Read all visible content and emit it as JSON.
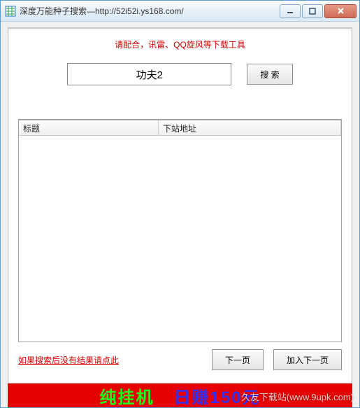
{
  "window": {
    "title": "深度万能种子搜索—http://52i52i.ys168.com/"
  },
  "hint": "请配合，讯雷、QQ旋风等下载工具",
  "search": {
    "value": "功夫2",
    "button": "搜 索"
  },
  "table": {
    "col1": "标题",
    "col2": "下站地址",
    "rows": []
  },
  "footer": {
    "no_result_link": "如果搜索后没有结果请点此",
    "prev": "下一页",
    "next": "加入下一页"
  },
  "ad": {
    "part1": "纯挂机",
    "part2": "日赚150元"
  },
  "watermark": {
    "line1": "久友下载站",
    "line2": "(www.9upk.com)"
  }
}
